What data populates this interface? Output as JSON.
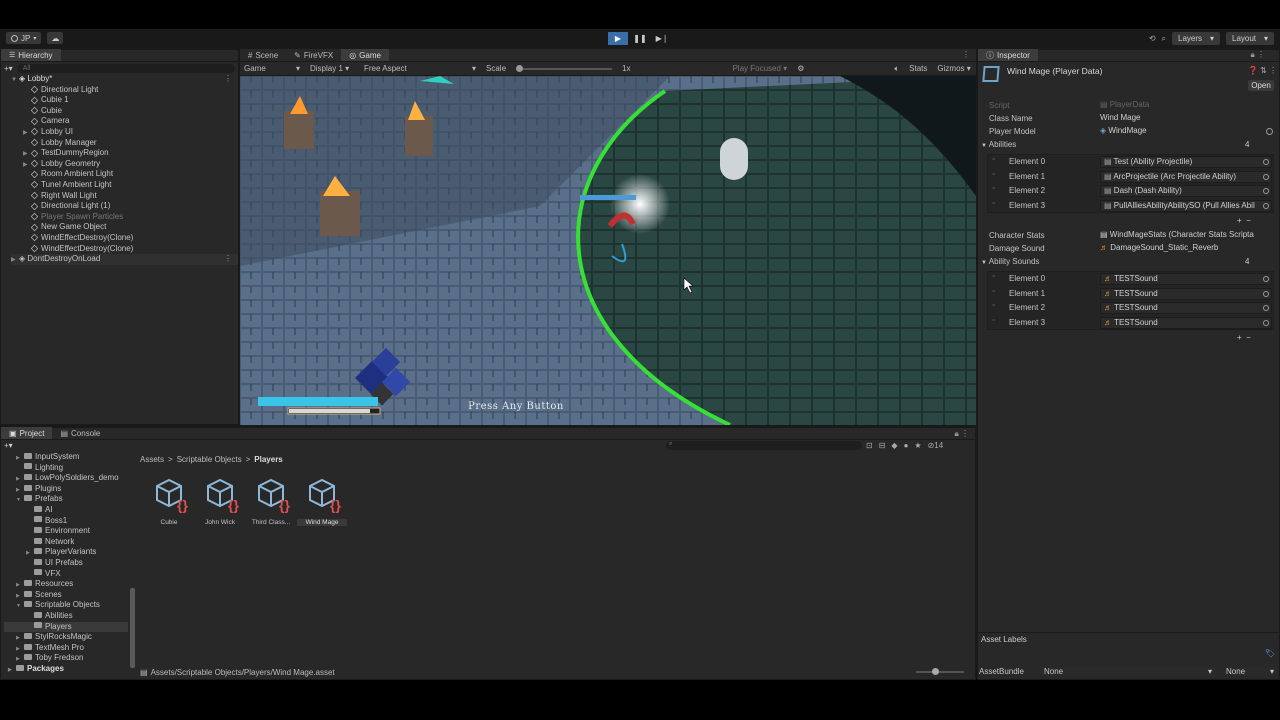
{
  "toolbar": {
    "account": "JP",
    "play_icons": [
      "play-icon",
      "pause-icon",
      "step-icon"
    ],
    "layers_label": "Layers",
    "layout_label": "Layout"
  },
  "hierarchy": {
    "tab": "Hierarchy",
    "search_placeholder": "All",
    "root": "Lobby*",
    "items": [
      {
        "label": "Directional Light",
        "dim": false
      },
      {
        "label": "Cubie 1",
        "dim": false
      },
      {
        "label": "Cubie",
        "dim": false
      },
      {
        "label": "Camera",
        "dim": false
      },
      {
        "label": "Lobby UI",
        "dim": false
      },
      {
        "label": "Lobby Manager",
        "dim": false
      },
      {
        "label": "TestDummyRegion",
        "dim": false
      },
      {
        "label": "Lobby Geometry",
        "dim": false
      },
      {
        "label": "Room Ambient Light",
        "dim": false
      },
      {
        "label": "Tunel Ambient Light",
        "dim": false
      },
      {
        "label": "Right Wall Light",
        "dim": false
      },
      {
        "label": "Directional Light (1)",
        "dim": false
      },
      {
        "label": "Player Spawn Particles",
        "dim": true
      },
      {
        "label": "New Game Object",
        "dim": false
      },
      {
        "label": "WindEffectDestroy(Clone)",
        "dim": false
      },
      {
        "label": "WindEffectDestroy(Clone)",
        "dim": false
      }
    ],
    "dont_destroy": "DontDestroyOnLoad"
  },
  "center_tabs": [
    "Scene",
    "FireVFX",
    "Game"
  ],
  "game_bar": {
    "mode": "Game",
    "display": "Display 1",
    "aspect": "Free Aspect",
    "scale_label": "Scale",
    "scale_value": "1x",
    "play_focused": "Play Focused",
    "stats": "Stats",
    "gizmos": "Gizmos"
  },
  "game": {
    "prompt": "Press Any Button",
    "health_fraction": 0.9
  },
  "inspector": {
    "tab": "Inspector",
    "title": "Wind Mage (Player Data)",
    "open_button": "Open",
    "script_label": "Script",
    "script_value": "PlayerData",
    "class_name_label": "Class Name",
    "class_name_value": "Wind Mage",
    "player_model_label": "Player Model",
    "player_model_value": "WindMage",
    "abilities_label": "Abilities",
    "abilities_count": "4",
    "abilities": [
      {
        "label": "Element 0",
        "value": "Test (Ability Projectile)"
      },
      {
        "label": "Element 1",
        "value": "ArcProjectile (Arc Projectile Ability)"
      },
      {
        "label": "Element 2",
        "value": "Dash (Dash Ability)"
      },
      {
        "label": "Element 3",
        "value": "PullAlliesAbilityAbilitySO (Pull Allies Abil"
      }
    ],
    "character_stats_label": "Character Stats",
    "character_stats_value": "WindMageStats (Character Stats Scripta",
    "damage_sound_label": "Damage Sound",
    "damage_sound_value": "DamageSound_Static_Reverb",
    "ability_sounds_label": "Ability Sounds",
    "ability_sounds_count": "4",
    "ability_sounds": [
      {
        "label": "Element 0",
        "value": "TESTSound"
      },
      {
        "label": "Element 1",
        "value": "TESTSound"
      },
      {
        "label": "Element 2",
        "value": "TESTSound"
      },
      {
        "label": "Element 3",
        "value": "TESTSound"
      }
    ],
    "asset_labels": "Asset Labels",
    "asset_bundle_label": "AssetBundle",
    "asset_bundle_value": "None",
    "asset_variant_value": "None"
  },
  "project": {
    "tabs": [
      "Project",
      "Console"
    ],
    "hidden_count": "14",
    "breadcrumb": [
      "Assets",
      "Scriptable Objects",
      "Players"
    ],
    "tree": [
      {
        "label": "InputSystem",
        "indent": 1,
        "arrow": true
      },
      {
        "label": "Lighting",
        "indent": 1,
        "arrow": false
      },
      {
        "label": "LowPolySoldiers_demo",
        "indent": 1,
        "arrow": true
      },
      {
        "label": "Plugins",
        "indent": 1,
        "arrow": true
      },
      {
        "label": "Prefabs",
        "indent": 1,
        "arrow": true,
        "open": true
      },
      {
        "label": "AI",
        "indent": 2,
        "arrow": false
      },
      {
        "label": "Boss1",
        "indent": 2,
        "arrow": false
      },
      {
        "label": "Environment",
        "indent": 2,
        "arrow": false
      },
      {
        "label": "Network",
        "indent": 2,
        "arrow": false
      },
      {
        "label": "PlayerVariants",
        "indent": 2,
        "arrow": true
      },
      {
        "label": "UI Prefabs",
        "indent": 2,
        "arrow": false
      },
      {
        "label": "VFX",
        "indent": 2,
        "arrow": false
      },
      {
        "label": "Resources",
        "indent": 1,
        "arrow": true
      },
      {
        "label": "Scenes",
        "indent": 1,
        "arrow": true
      },
      {
        "label": "Scriptable Objects",
        "indent": 1,
        "arrow": true,
        "open": true
      },
      {
        "label": "Abilities",
        "indent": 2,
        "arrow": false
      },
      {
        "label": "Players",
        "indent": 2,
        "arrow": false,
        "selected": true
      },
      {
        "label": "StylRocksMagic",
        "indent": 1,
        "arrow": true
      },
      {
        "label": "TextMesh Pro",
        "indent": 1,
        "arrow": true
      },
      {
        "label": "Toby Fredson",
        "indent": 1,
        "arrow": true
      },
      {
        "label": "Packages",
        "indent": 0,
        "arrow": true,
        "bold": true
      }
    ],
    "assets": [
      {
        "label": "Cubie",
        "selected": false
      },
      {
        "label": "John Wick",
        "selected": false
      },
      {
        "label": "Third Class...",
        "selected": false
      },
      {
        "label": "Wind Mage",
        "selected": true
      }
    ],
    "path": "Assets/Scriptable Objects/Players/Wind Mage.asset"
  }
}
